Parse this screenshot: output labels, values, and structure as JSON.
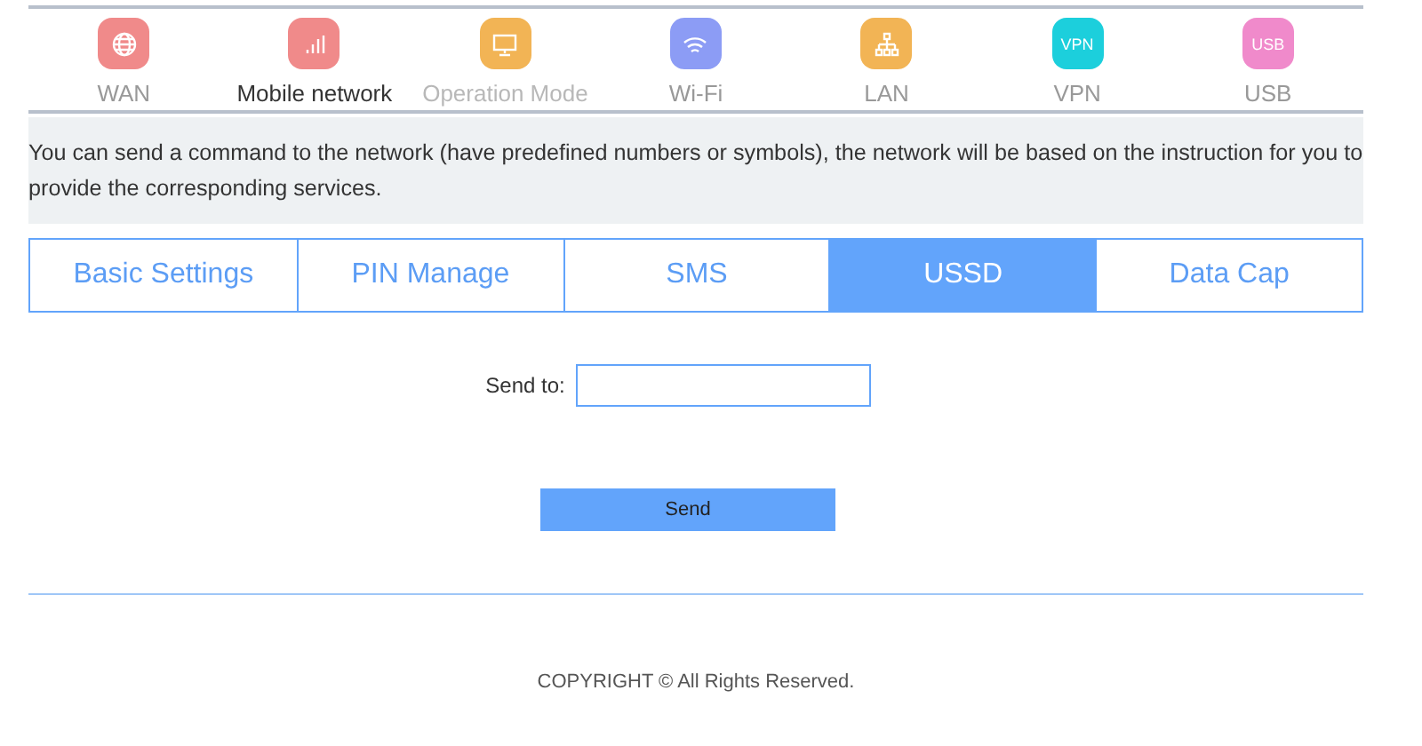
{
  "nav": [
    {
      "label": "WAN",
      "kind": "globe",
      "color": "#f08a8a",
      "selected": false,
      "disabled": false
    },
    {
      "label": "Mobile network",
      "kind": "signal",
      "color": "#f08a8a",
      "selected": true,
      "disabled": false
    },
    {
      "label": "Operation Mode",
      "kind": "monitor",
      "color": "#f2b455",
      "selected": false,
      "disabled": true
    },
    {
      "label": "Wi-Fi",
      "kind": "wifi",
      "color": "#8c9cf5",
      "selected": false,
      "disabled": false
    },
    {
      "label": "LAN",
      "kind": "tree",
      "color": "#f2b455",
      "selected": false,
      "disabled": false
    },
    {
      "label": "VPN",
      "kind": "text",
      "icon_text": "VPN",
      "color": "#1ccfdc",
      "selected": false,
      "disabled": false
    },
    {
      "label": "USB",
      "kind": "text",
      "icon_text": "USB",
      "color": "#f08acb",
      "selected": false,
      "disabled": false
    }
  ],
  "description": "You can send a command to the network (have predefined numbers or symbols), the network will be based on the instruction for you to provide the corresponding services.",
  "tabs": [
    {
      "label": "Basic Settings",
      "selected": false
    },
    {
      "label": "PIN Manage",
      "selected": false
    },
    {
      "label": "SMS",
      "selected": false
    },
    {
      "label": "USSD",
      "selected": true
    },
    {
      "label": "Data Cap",
      "selected": false
    }
  ],
  "form": {
    "label": "Send to:",
    "button": "Send"
  },
  "footer": "COPYRIGHT © All Rights Reserved."
}
